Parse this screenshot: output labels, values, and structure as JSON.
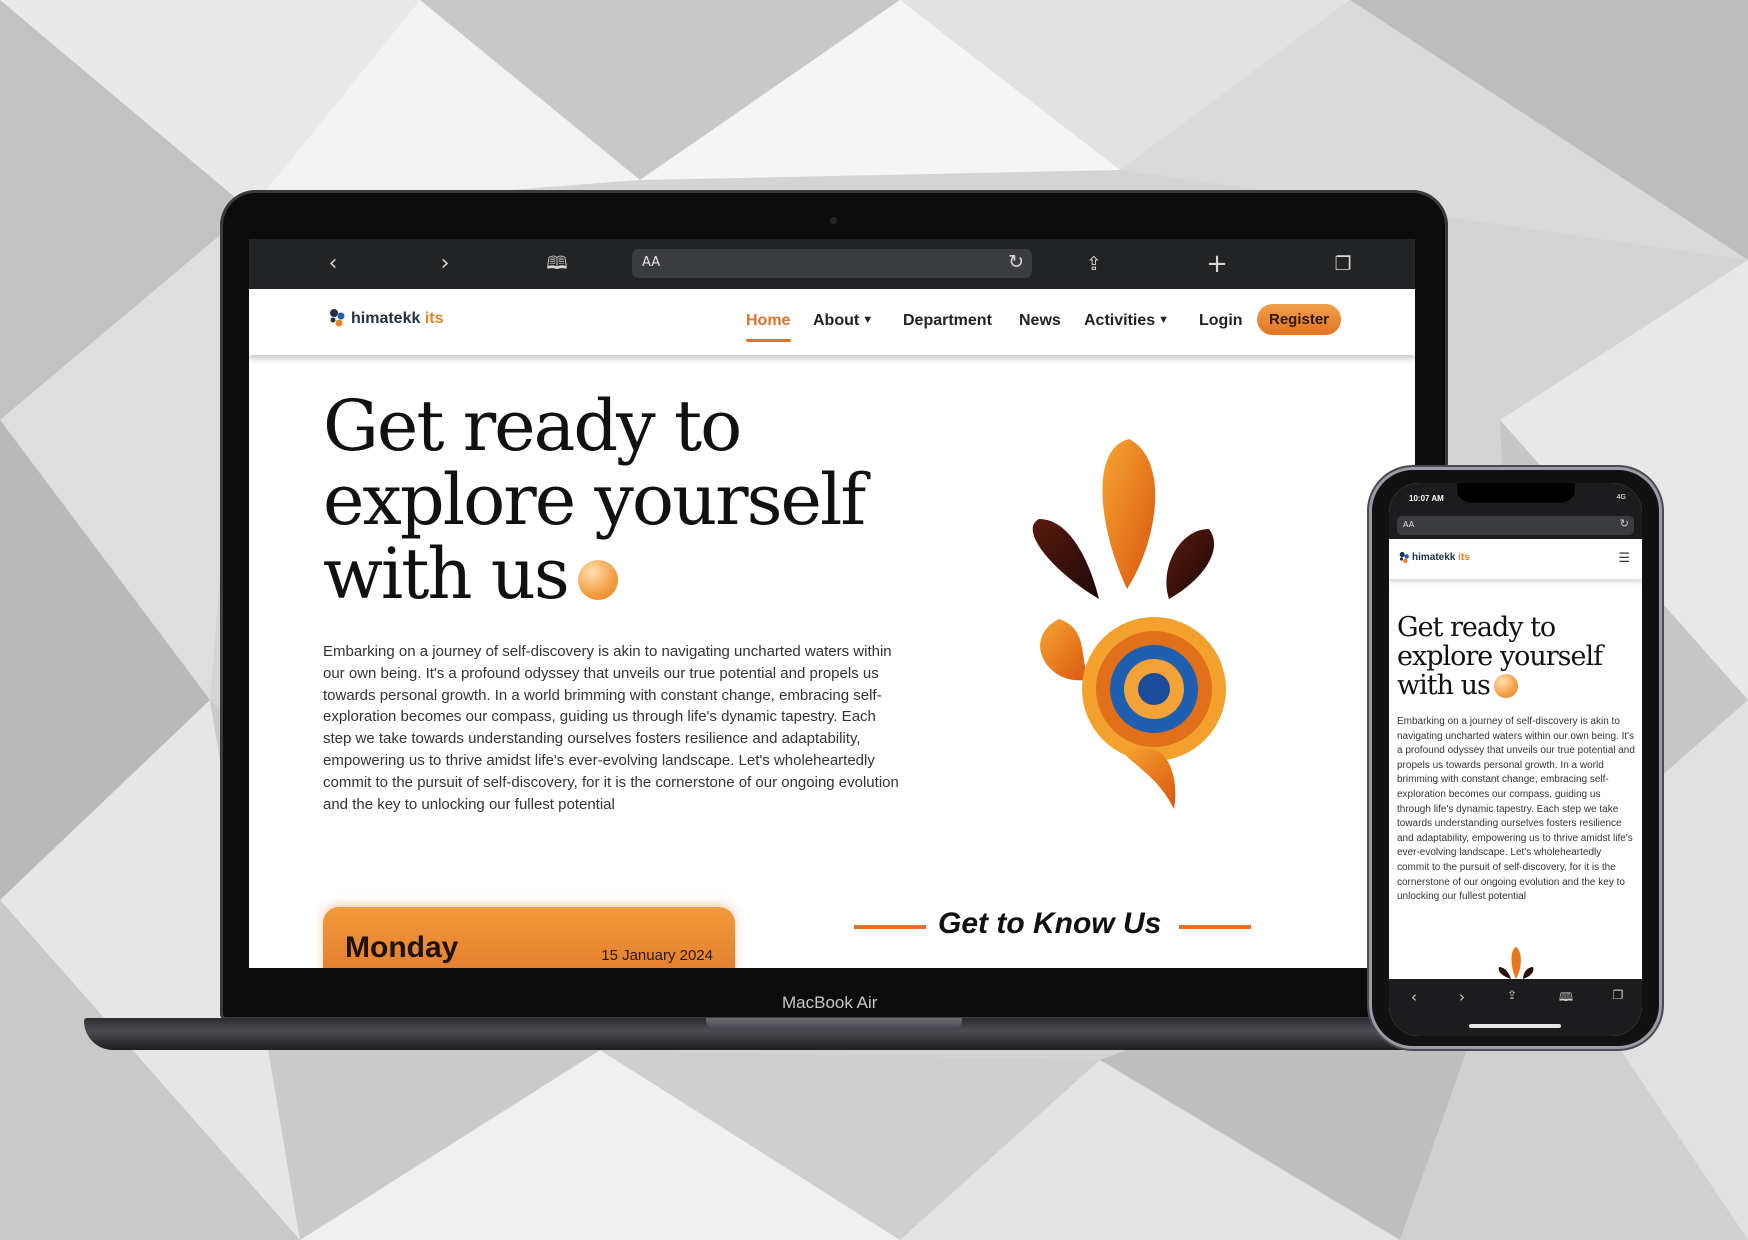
{
  "laptop": {
    "device_label": "MacBook Air",
    "browser": {
      "back_icon": "chevron-left-icon",
      "forward_icon": "chevron-right-icon",
      "bookmarks_icon": "book-icon",
      "url_aa": "AA",
      "reload_icon": "reload-icon",
      "share_icon": "share-icon",
      "new_tab_icon": "plus-icon",
      "tabs_icon": "tabs-icon"
    },
    "nav": {
      "logo_name": "himatekk",
      "logo_accent": "its",
      "items": [
        {
          "label": "Home",
          "active": true
        },
        {
          "label": "About",
          "dropdown": true
        },
        {
          "label": "Department"
        },
        {
          "label": "News"
        },
        {
          "label": "Activities",
          "dropdown": true
        },
        {
          "label": "Login"
        }
      ],
      "register_label": "Register"
    },
    "hero": {
      "title_line1": "Get ready to",
      "title_line2": "explore yourself",
      "title_line3": "with us",
      "body": "Embarking on a journey of self-discovery is akin to navigating uncharted waters within our own being. It's a profound odyssey that unveils our true potential and propels us towards personal growth. In a world brimming with constant change, embracing self-exploration becomes our compass, guiding us through life's dynamic tapestry. Each step we take towards understanding ourselves fosters resilience and adaptability, empowering us to thrive amidst life's ever-evolving landscape. Let's wholeheartedly commit to the pursuit of self-discovery, for it is the cornerstone of our ongoing evolution and the key to unlocking our fullest potential"
    },
    "date_card": {
      "day": "Monday",
      "date": "15 January 2024"
    },
    "section_title": "Get to Know Us"
  },
  "phone": {
    "status_time": "10:07 AM",
    "status_signal": "4G",
    "url_aa": "AA",
    "logo_name": "himatekk",
    "logo_accent": "its",
    "menu_icon": "hamburger-menu-icon",
    "hero": {
      "title_line1": "Get ready to",
      "title_line2": "explore yourself",
      "title_line3": "with us",
      "body": "Embarking on a journey of self-discovery is akin to navigating uncharted waters within our own being. It's a profound odyssey that unveils our true potential and propels us towards personal growth. In a world brimming with constant change, embracing self-exploration becomes our compass, guiding us through life's dynamic tapestry. Each step we take towards understanding ourselves fosters resilience and adaptability, empowering us to thrive amidst life's ever-evolving landscape. Let's wholeheartedly commit to the pursuit of self-discovery, for it is the cornerstone of our ongoing evolution and the key to unlocking our fullest potential"
    }
  },
  "colors": {
    "accent_orange": "#e0702a",
    "navy": "#233044",
    "blue": "#1e5fb0"
  }
}
